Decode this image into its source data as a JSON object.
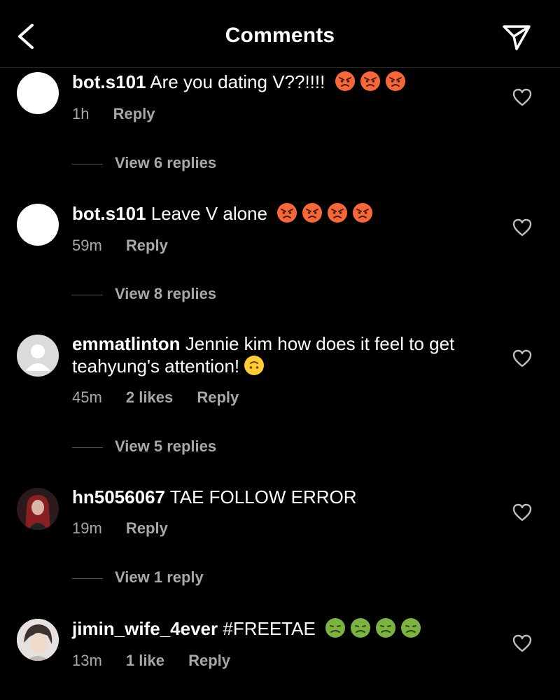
{
  "header": {
    "title": "Comments"
  },
  "comments": [
    {
      "username": "bot.s101",
      "text": "Are you dating V??!!!!",
      "emoji": "angry",
      "emoji_count": 3,
      "time": "1h",
      "likes": "",
      "reply": "Reply",
      "view_replies": "View 6 replies"
    },
    {
      "username": "bot.s101",
      "text": "Leave V alone",
      "emoji": "angry",
      "emoji_count": 4,
      "time": "59m",
      "likes": "",
      "reply": "Reply",
      "view_replies": "View 8 replies"
    },
    {
      "username": "emmatlinton",
      "text": "Jennie kim how does it feel to get teahyung's attention!",
      "emoji": "upside-down",
      "emoji_count": 1,
      "time": "45m",
      "likes": "2 likes",
      "reply": "Reply",
      "view_replies": "View 5 replies"
    },
    {
      "username": "hn5056067",
      "text": "TAE FOLLOW ERROR",
      "emoji": "",
      "emoji_count": 0,
      "time": "19m",
      "likes": "",
      "reply": "Reply",
      "view_replies": "View 1 reply"
    },
    {
      "username": "jimin_wife_4ever",
      "text": "#FREETAE",
      "emoji": "nauseated",
      "emoji_count": 4,
      "time": "13m",
      "likes": "1 like",
      "reply": "Reply",
      "view_replies": ""
    }
  ]
}
